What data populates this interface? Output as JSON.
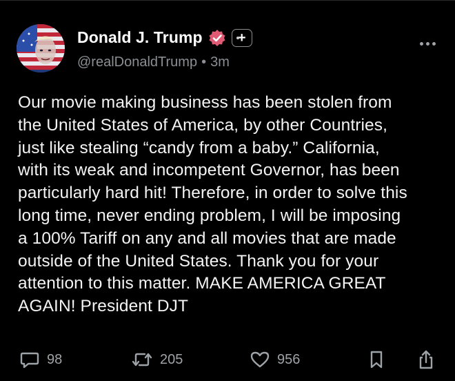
{
  "author": {
    "display_name": "Donald J. Trump",
    "handle": "@realDonaldTrump",
    "separator": "•",
    "timestamp": "3m",
    "verified_color": "#e05a74",
    "avatar_icon": "avatar-flag-portrait"
  },
  "post": {
    "text": "Our movie making business has been stolen from\nthe United States of America, by other Countries,\njust like stealing “candy from a baby.” California,\nwith its weak and incompetent Governor, has been\nparticularly hard hit! Therefore, in order to solve this\nlong time, never ending problem, I will be imposing\na 100% Tariff on any and all movies that are made\noutside of the United States. Thank you for your\nattention to this matter. MAKE AMERICA GREAT\nAGAIN! President DJT"
  },
  "actions": {
    "reply_count": "98",
    "retruth_count": "205",
    "like_count": "956"
  },
  "icons": {
    "reply": "speech-bubble-icon",
    "retruth": "repost-arrows-icon",
    "like": "heart-icon",
    "bookmark": "bookmark-icon",
    "share": "share-icon",
    "more": "more-options-icon"
  },
  "colors": {
    "background": "#000000",
    "text": "#f3f3f3",
    "muted": "#8b8f94"
  }
}
